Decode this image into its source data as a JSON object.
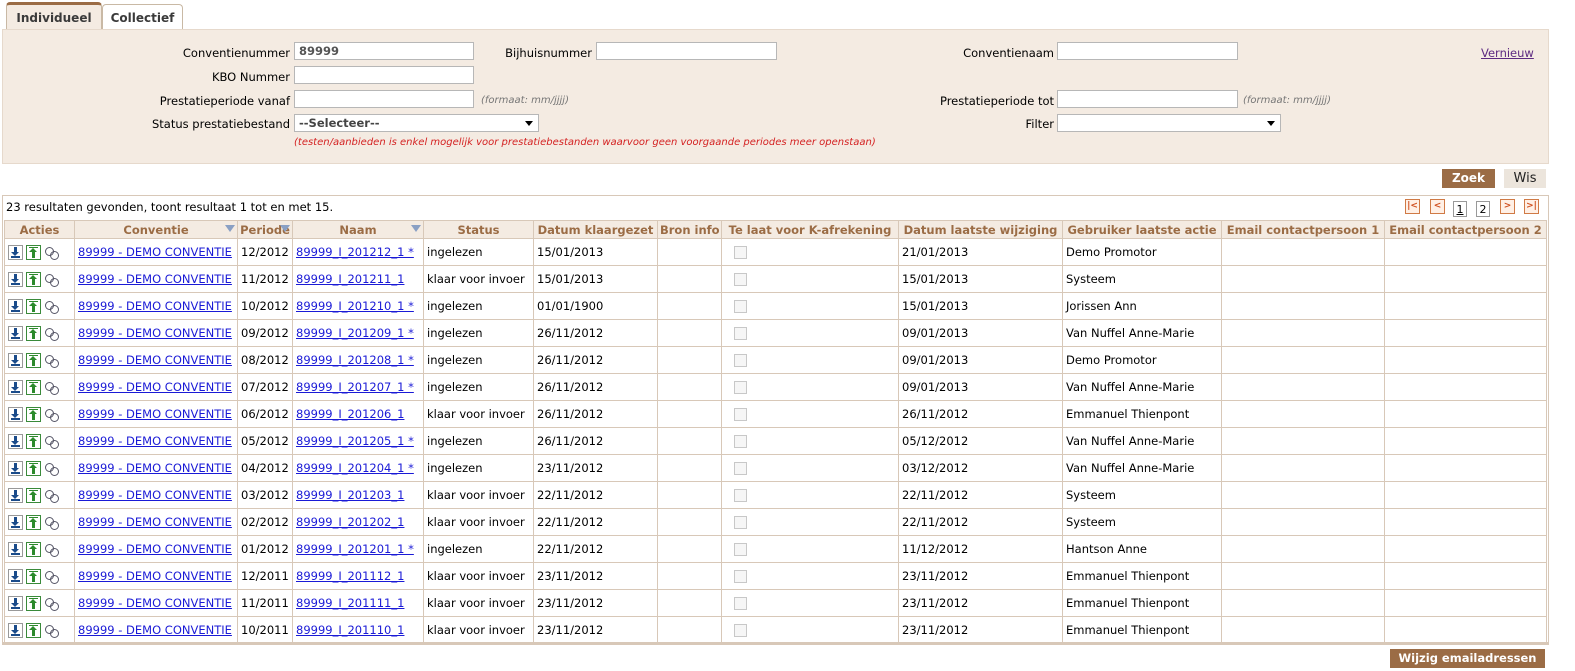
{
  "tabs": [
    {
      "label": "Individueel",
      "active": true
    },
    {
      "label": "Collectief",
      "active": false
    }
  ],
  "filters": {
    "conventienummer_label": "Conventienummer",
    "conventienummer_value": "89999",
    "bijhuisnummer_label": "Bijhuisnummer",
    "bijhuisnummer_value": "",
    "conventienaam_label": "Conventienaam",
    "conventienaam_value": "",
    "vernieuw_link": "Vernieuw",
    "kbo_label": "KBO Nummer",
    "kbo_value": "",
    "periode_vanaf_label": "Prestatieperiode vanaf",
    "periode_vanaf_value": "",
    "periode_tot_label": "Prestatieperiode tot",
    "periode_tot_value": "",
    "format_hint": "(formaat: mm/jjjj)",
    "status_label": "Status prestatiebestand",
    "status_selected": "--Selecteer--",
    "filter_label": "Filter",
    "filter_selected": "",
    "warning": "(testen/aanbieden is enkel mogelijk voor prestatiebestanden waarvoor geen voorgaande periodes meer openstaan)"
  },
  "buttons": {
    "zoek": "Zoek",
    "wis": "Wis",
    "wijzig": "Wijzig emailadressen"
  },
  "results": {
    "summary": "23 resultaten gevonden, toont resultaat 1 tot en met 15.",
    "pages": [
      "1",
      "2"
    ],
    "current_page": "1"
  },
  "table": {
    "headers": [
      "Acties",
      "Conventie",
      "Periode",
      "Naam",
      "Status",
      "Datum klaargezet",
      "Bron info",
      "Te laat voor K-afrekening",
      "Datum laatste wijziging",
      "Gebruiker laatste actie",
      "Email contactpersoon 1",
      "Email contactpersoon 2"
    ],
    "rows": [
      {
        "conventie": "89999 - DEMO CONVENTIE",
        "periode": "12/2012",
        "naam": "89999_I_201212_1 *",
        "status": "ingelezen",
        "klaargezet": "15/01/2013",
        "bron": "",
        "wijziging": "21/01/2013",
        "gebruiker": "Demo Promotor",
        "email1": "",
        "email2": ""
      },
      {
        "conventie": "89999 - DEMO CONVENTIE",
        "periode": "11/2012",
        "naam": "89999_I_201211_1",
        "status": "klaar voor invoer",
        "klaargezet": "15/01/2013",
        "bron": "",
        "wijziging": "15/01/2013",
        "gebruiker": "Systeem",
        "email1": "",
        "email2": ""
      },
      {
        "conventie": "89999 - DEMO CONVENTIE",
        "periode": "10/2012",
        "naam": "89999_I_201210_1 *",
        "status": "ingelezen",
        "klaargezet": "01/01/1900",
        "bron": "",
        "wijziging": "15/01/2013",
        "gebruiker": "Jorissen Ann",
        "email1": "",
        "email2": ""
      },
      {
        "conventie": "89999 - DEMO CONVENTIE",
        "periode": "09/2012",
        "naam": "89999_I_201209_1 *",
        "status": "ingelezen",
        "klaargezet": "26/11/2012",
        "bron": "",
        "wijziging": "09/01/2013",
        "gebruiker": "Van Nuffel Anne-Marie",
        "email1": "",
        "email2": ""
      },
      {
        "conventie": "89999 - DEMO CONVENTIE",
        "periode": "08/2012",
        "naam": "89999_I_201208_1 *",
        "status": "ingelezen",
        "klaargezet": "26/11/2012",
        "bron": "",
        "wijziging": "09/01/2013",
        "gebruiker": "Demo Promotor",
        "email1": "",
        "email2": ""
      },
      {
        "conventie": "89999 - DEMO CONVENTIE",
        "periode": "07/2012",
        "naam": "89999_I_201207_1 *",
        "status": "ingelezen",
        "klaargezet": "26/11/2012",
        "bron": "",
        "wijziging": "09/01/2013",
        "gebruiker": "Van Nuffel Anne-Marie",
        "email1": "",
        "email2": ""
      },
      {
        "conventie": "89999 - DEMO CONVENTIE",
        "periode": "06/2012",
        "naam": "89999_I_201206_1",
        "status": "klaar voor invoer",
        "klaargezet": "26/11/2012",
        "bron": "",
        "wijziging": "26/11/2012",
        "gebruiker": "Emmanuel Thienpont",
        "email1": "",
        "email2": ""
      },
      {
        "conventie": "89999 - DEMO CONVENTIE",
        "periode": "05/2012",
        "naam": "89999_I_201205_1 *",
        "status": "ingelezen",
        "klaargezet": "26/11/2012",
        "bron": "",
        "wijziging": "05/12/2012",
        "gebruiker": "Van Nuffel Anne-Marie",
        "email1": "",
        "email2": ""
      },
      {
        "conventie": "89999 - DEMO CONVENTIE",
        "periode": "04/2012",
        "naam": "89999_I_201204_1 *",
        "status": "ingelezen",
        "klaargezet": "23/11/2012",
        "bron": "",
        "wijziging": "03/12/2012",
        "gebruiker": "Van Nuffel Anne-Marie",
        "email1": "",
        "email2": ""
      },
      {
        "conventie": "89999 - DEMO CONVENTIE",
        "periode": "03/2012",
        "naam": "89999_I_201203_1",
        "status": "klaar voor invoer",
        "klaargezet": "22/11/2012",
        "bron": "",
        "wijziging": "22/11/2012",
        "gebruiker": "Systeem",
        "email1": "",
        "email2": ""
      },
      {
        "conventie": "89999 - DEMO CONVENTIE",
        "periode": "02/2012",
        "naam": "89999_I_201202_1",
        "status": "klaar voor invoer",
        "klaargezet": "22/11/2012",
        "bron": "",
        "wijziging": "22/11/2012",
        "gebruiker": "Systeem",
        "email1": "",
        "email2": ""
      },
      {
        "conventie": "89999 - DEMO CONVENTIE",
        "periode": "01/2012",
        "naam": "89999_I_201201_1 *",
        "status": "ingelezen",
        "klaargezet": "22/11/2012",
        "bron": "",
        "wijziging": "11/12/2012",
        "gebruiker": "Hantson Anne",
        "email1": "",
        "email2": ""
      },
      {
        "conventie": "89999 - DEMO CONVENTIE",
        "periode": "12/2011",
        "naam": "89999_I_201112_1",
        "status": "klaar voor invoer",
        "klaargezet": "23/11/2012",
        "bron": "",
        "wijziging": "23/11/2012",
        "gebruiker": "Emmanuel Thienpont",
        "email1": "",
        "email2": ""
      },
      {
        "conventie": "89999 - DEMO CONVENTIE",
        "periode": "11/2011",
        "naam": "89999_I_201111_1",
        "status": "klaar voor invoer",
        "klaargezet": "23/11/2012",
        "bron": "",
        "wijziging": "23/11/2012",
        "gebruiker": "Emmanuel Thienpont",
        "email1": "",
        "email2": ""
      },
      {
        "conventie": "89999 - DEMO CONVENTIE",
        "periode": "10/2011",
        "naam": "89999_I_201110_1",
        "status": "klaar voor invoer",
        "klaargezet": "23/11/2012",
        "bron": "",
        "wijziging": "23/11/2012",
        "gebruiker": "Emmanuel Thienpont",
        "email1": "",
        "email2": ""
      }
    ]
  },
  "colors": {
    "accent": "#9b6c45",
    "panel_bg": "#f4ebe2",
    "link": "#1a1ad6",
    "warning": "#d42222"
  },
  "icons": [
    "download-icon",
    "upload-icon",
    "scissors-icon",
    "first-page-icon",
    "prev-page-icon",
    "next-page-icon",
    "last-page-icon"
  ]
}
